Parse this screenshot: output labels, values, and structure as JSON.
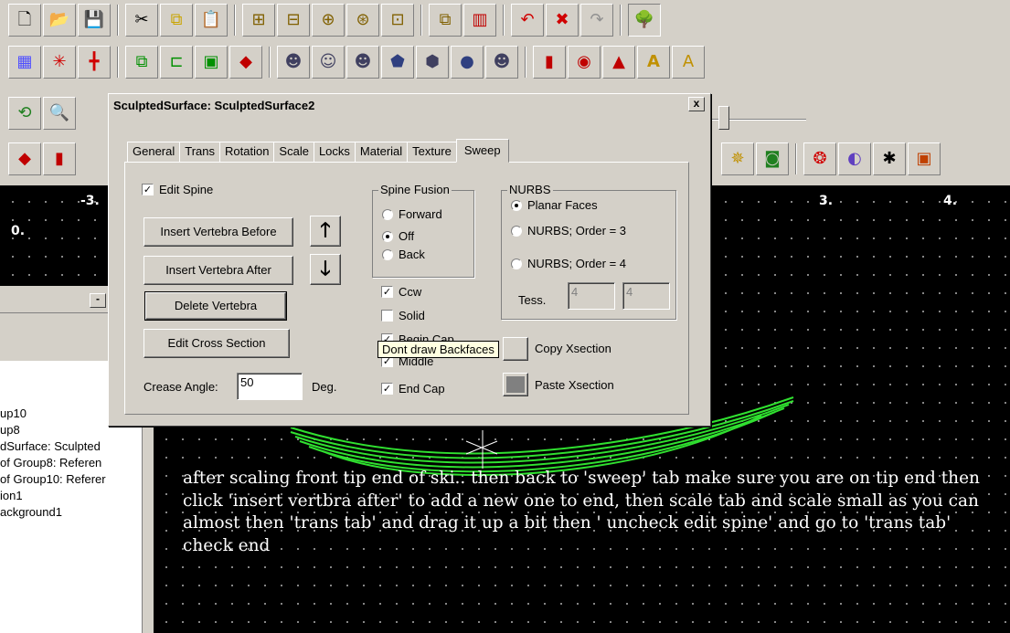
{
  "dialog": {
    "title": "SculptedSurface: SculptedSurface2",
    "close_label": "x",
    "tabs": [
      "General",
      "Trans",
      "Rotation",
      "Scale",
      "Locks",
      "Material",
      "Texture",
      "Sweep"
    ],
    "active_tab": "Sweep",
    "edit_spine_label": "Edit Spine",
    "insert_before_label": "Insert Vertebra Before",
    "insert_after_label": "Insert Vertebra After",
    "delete_label": "Delete Vertebra",
    "edit_cross_label": "Edit Cross Section",
    "crease_label": "Crease Angle:",
    "crease_value": "50",
    "crease_unit": "Deg.",
    "spine_fusion": {
      "legend": "Spine Fusion",
      "options": [
        "Forward",
        "Off",
        "Back"
      ],
      "selected": "Off"
    },
    "nurbs": {
      "legend": "NURBS",
      "options": [
        "Planar Faces",
        "NURBS; Order = 3",
        "NURBS; Order = 4"
      ],
      "selected": "Planar Faces",
      "tess_label": "Tess.",
      "tess_1": "4",
      "tess_2": "4"
    },
    "checks": {
      "ccw": "Ccw",
      "solid": "Solid",
      "begin_cap": "Begin Cap",
      "middle": "Middle",
      "end_cap": "End Cap"
    },
    "copy_xsection": "Copy Xsection",
    "paste_xsection": "Paste Xsection",
    "tooltip": "Dont draw Backfaces"
  },
  "viewport": {
    "axis_labels": [
      "-3.",
      "3.",
      "4.",
      "0."
    ],
    "note": "after scaling front tip end of ski.. then back to 'sweep' tab make sure you are on tip end then click 'insert vertbra after' to add a new one to end, then scale tab and scale small as you can almost then 'trans tab' and drag it up a bit then ' uncheck edit spine' and go to 'trans tab' check end"
  },
  "leftpanel": {
    "minimize_label": "-",
    "tree_items": [
      "up10",
      "up8",
      "dSurface: Sculpted",
      "of Group8: Referen",
      "of Group10: Referer",
      "ion1",
      "ackground1"
    ]
  },
  "toolbar": {
    "row1_icons": [
      "new-file-icon",
      "open-folder-icon",
      "save-icon",
      "cut-icon",
      "copy-icon",
      "paste-icon",
      "tool-a-icon",
      "tool-b-icon",
      "tool-c-icon",
      "tool-d-icon",
      "tool-e-icon",
      "tool-f-icon",
      "tool-g-icon",
      "undo-icon",
      "cancel-icon",
      "redo-icon",
      "tree-icon"
    ],
    "row2_icons": [
      "grid-icon",
      "snap-icon",
      "axis-icon",
      "group-icon",
      "ungroup-icon",
      "merge-icon",
      "cube-icon",
      "head-a-icon",
      "head-b-icon",
      "head-c-icon",
      "head-d-icon",
      "head-e-icon",
      "head-f-icon",
      "head-g-icon",
      "door-icon",
      "disc-icon",
      "cone-icon",
      "text-a-icon",
      "text-b-icon"
    ],
    "row3_icons": [
      "rotate-view-icon",
      "zoom-icon"
    ],
    "row4_icons": [
      "cube-red-icon",
      "cylinder-icon"
    ],
    "row4_right_icons": [
      "wheel-icon",
      "sphere-box-icon",
      "twist-icon",
      "globe-icon",
      "spider-icon",
      "box-icon"
    ]
  }
}
